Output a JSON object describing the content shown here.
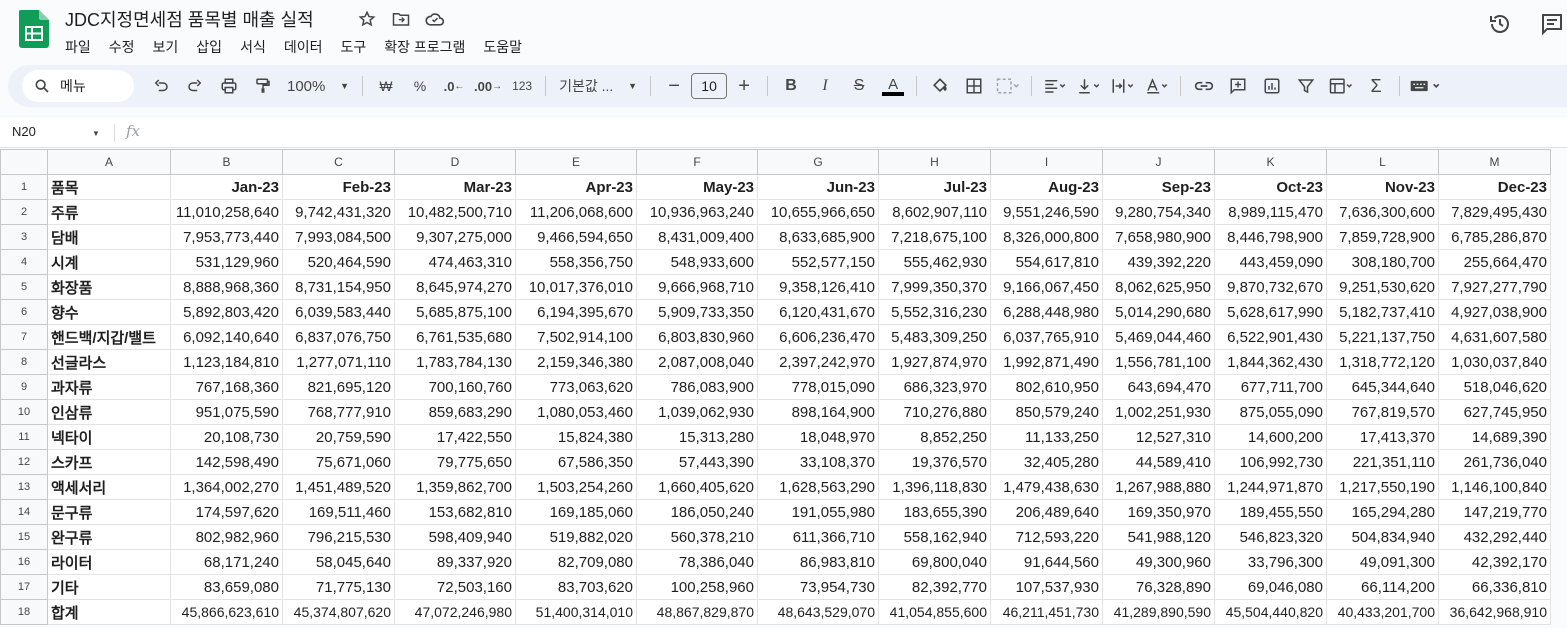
{
  "doc": {
    "title": "JDC지정면세점 품목별 매출 실적"
  },
  "menu": [
    "파일",
    "수정",
    "보기",
    "삽입",
    "서식",
    "데이터",
    "도구",
    "확장 프로그램",
    "도움말"
  ],
  "toolbar": {
    "search_label": "메뉴",
    "zoom": "100%",
    "currency": "₩",
    "percent": "%",
    "dec_less": ".0",
    "dec_more": ".00",
    "number_format": "123",
    "font": "기본값 ...",
    "font_size": "10",
    "bold": "B",
    "italic": "I",
    "strike": "S",
    "text_color": "A"
  },
  "formula_bar": {
    "cell_ref": "N20",
    "fx": "fx"
  },
  "columns": [
    "A",
    "B",
    "C",
    "D",
    "E",
    "F",
    "G",
    "H",
    "I",
    "J",
    "K",
    "L",
    "M"
  ],
  "row_numbers": [
    "1",
    "2",
    "3",
    "4",
    "5",
    "6",
    "7",
    "8",
    "9",
    "10",
    "11",
    "12",
    "13",
    "14",
    "15",
    "16",
    "17",
    "18"
  ],
  "header_row": [
    "품목",
    "Jan-23",
    "Feb-23",
    "Mar-23",
    "Apr-23",
    "May-23",
    "Jun-23",
    "Jul-23",
    "Aug-23",
    "Sep-23",
    "Oct-23",
    "Nov-23",
    "Dec-23"
  ],
  "rows": [
    [
      "주류",
      "11,010,258,640",
      "9,742,431,320",
      "10,482,500,710",
      "11,206,068,600",
      "10,936,963,240",
      "10,655,966,650",
      "8,602,907,110",
      "9,551,246,590",
      "9,280,754,340",
      "8,989,115,470",
      "7,636,300,600",
      "7,829,495,430"
    ],
    [
      "담배",
      "7,953,773,440",
      "7,993,084,500",
      "9,307,275,000",
      "9,466,594,650",
      "8,431,009,400",
      "8,633,685,900",
      "7,218,675,100",
      "8,326,000,800",
      "7,658,980,900",
      "8,446,798,900",
      "7,859,728,900",
      "6,785,286,870"
    ],
    [
      "시계",
      "531,129,960",
      "520,464,590",
      "474,463,310",
      "558,356,750",
      "548,933,600",
      "552,577,150",
      "555,462,930",
      "554,617,810",
      "439,392,220",
      "443,459,090",
      "308,180,700",
      "255,664,470"
    ],
    [
      "화장품",
      "8,888,968,360",
      "8,731,154,950",
      "8,645,974,270",
      "10,017,376,010",
      "9,666,968,710",
      "9,358,126,410",
      "7,999,350,370",
      "9,166,067,450",
      "8,062,625,950",
      "9,870,732,670",
      "9,251,530,620",
      "7,927,277,790"
    ],
    [
      "향수",
      "5,892,803,420",
      "6,039,583,440",
      "5,685,875,100",
      "6,194,395,670",
      "5,909,733,350",
      "6,120,431,670",
      "5,552,316,230",
      "6,288,448,980",
      "5,014,290,680",
      "5,628,617,990",
      "5,182,737,410",
      "4,927,038,900"
    ],
    [
      "핸드백/지갑/밸트",
      "6,092,140,640",
      "6,837,076,750",
      "6,761,535,680",
      "7,502,914,100",
      "6,803,830,960",
      "6,606,236,470",
      "5,483,309,250",
      "6,037,765,910",
      "5,469,044,460",
      "6,522,901,430",
      "5,221,137,750",
      "4,631,607,580"
    ],
    [
      "선글라스",
      "1,123,184,810",
      "1,277,071,110",
      "1,783,784,130",
      "2,159,346,380",
      "2,087,008,040",
      "2,397,242,970",
      "1,927,874,970",
      "1,992,871,490",
      "1,556,781,100",
      "1,844,362,430",
      "1,318,772,120",
      "1,030,037,840"
    ],
    [
      "과자류",
      "767,168,360",
      "821,695,120",
      "700,160,760",
      "773,063,620",
      "786,083,900",
      "778,015,090",
      "686,323,970",
      "802,610,950",
      "643,694,470",
      "677,711,700",
      "645,344,640",
      "518,046,620"
    ],
    [
      "인삼류",
      "951,075,590",
      "768,777,910",
      "859,683,290",
      "1,080,053,460",
      "1,039,062,930",
      "898,164,900",
      "710,276,880",
      "850,579,240",
      "1,002,251,930",
      "875,055,090",
      "767,819,570",
      "627,745,950"
    ],
    [
      "넥타이",
      "20,108,730",
      "20,759,590",
      "17,422,550",
      "15,824,380",
      "15,313,280",
      "18,048,970",
      "8,852,250",
      "11,133,250",
      "12,527,310",
      "14,600,200",
      "17,413,370",
      "14,689,390"
    ],
    [
      "스카프",
      "142,598,490",
      "75,671,060",
      "79,775,650",
      "67,586,350",
      "57,443,390",
      "33,108,370",
      "19,376,570",
      "32,405,280",
      "44,589,410",
      "106,992,730",
      "221,351,110",
      "261,736,040"
    ],
    [
      "액세서리",
      "1,364,002,270",
      "1,451,489,520",
      "1,359,862,700",
      "1,503,254,260",
      "1,660,405,620",
      "1,628,563,290",
      "1,396,118,830",
      "1,479,438,630",
      "1,267,988,880",
      "1,244,971,870",
      "1,217,550,190",
      "1,146,100,840"
    ],
    [
      "문구류",
      "174,597,620",
      "169,511,460",
      "153,682,810",
      "169,185,060",
      "186,050,240",
      "191,055,980",
      "183,655,390",
      "206,489,640",
      "169,350,970",
      "189,455,550",
      "165,294,280",
      "147,219,770"
    ],
    [
      "완구류",
      "802,982,960",
      "796,215,530",
      "598,409,940",
      "519,882,020",
      "560,378,210",
      "611,366,710",
      "558,162,940",
      "712,593,220",
      "541,988,120",
      "546,823,320",
      "504,834,940",
      "432,292,440"
    ],
    [
      "라이터",
      "68,171,240",
      "58,045,640",
      "89,337,920",
      "82,709,080",
      "78,386,040",
      "86,983,810",
      "69,800,040",
      "91,644,560",
      "49,300,960",
      "33,796,300",
      "49,091,300",
      "42,392,170"
    ],
    [
      "기타",
      "83,659,080",
      "71,775,130",
      "72,503,160",
      "83,703,620",
      "100,258,960",
      "73,954,730",
      "82,392,770",
      "107,537,930",
      "76,328,890",
      "69,046,080",
      "66,114,200",
      "66,336,810"
    ]
  ],
  "total_row": [
    "합계",
    "45,866,623,610",
    "45,374,807,620",
    "47,072,246,980",
    "51,400,314,010",
    "48,867,829,870",
    "48,643,529,070",
    "41,054,855,600",
    "46,211,451,730",
    "41,289,890,590",
    "45,504,440,820",
    "40,433,201,700",
    "36,642,968,910"
  ]
}
